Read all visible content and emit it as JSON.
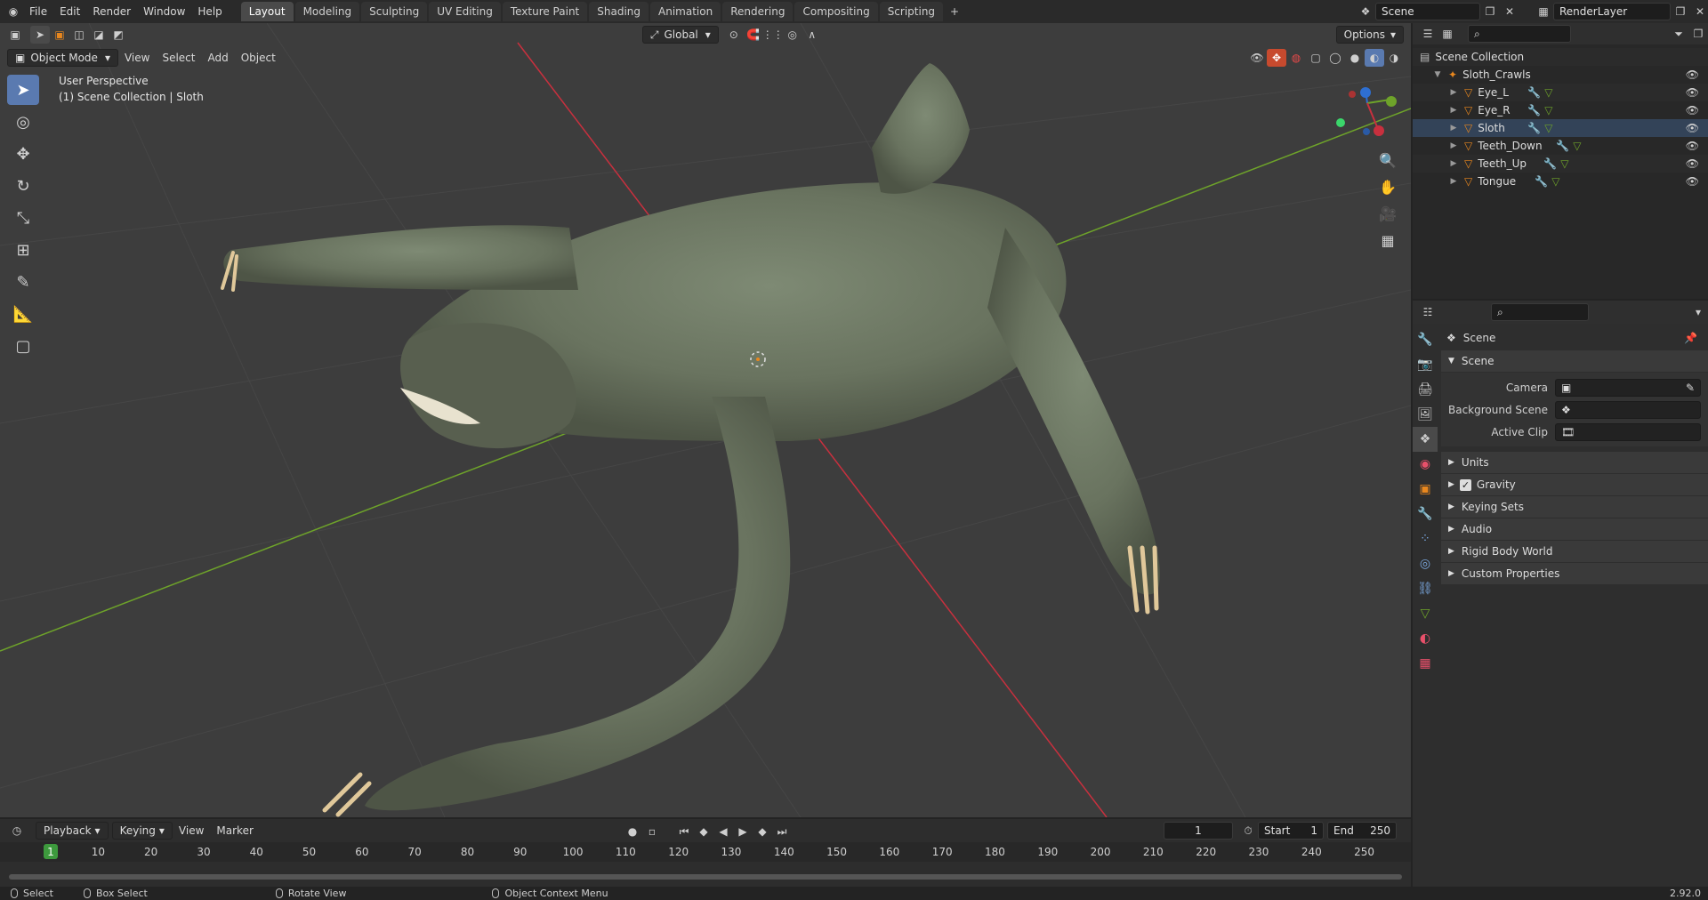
{
  "menu": {
    "file": "File",
    "edit": "Edit",
    "render": "Render",
    "window": "Window",
    "help": "Help"
  },
  "workspaces": [
    "Layout",
    "Modeling",
    "Sculpting",
    "UV Editing",
    "Texture Paint",
    "Shading",
    "Animation",
    "Rendering",
    "Compositing",
    "Scripting"
  ],
  "topright": {
    "scene": "Scene",
    "render_layer": "RenderLayer",
    "add_tab": "+"
  },
  "viewport": {
    "mode": "Object Mode",
    "view": "View",
    "select": "Select",
    "add": "Add",
    "object": "Object",
    "orientation": "Global",
    "options": "Options",
    "info_line1": "User Perspective",
    "info_line2": "(1) Scene Collection | Sloth"
  },
  "outliner": {
    "root": "Scene Collection",
    "collection": "Sloth_Crawls",
    "objects": [
      "Eye_L",
      "Eye_R",
      "Sloth",
      "Teeth_Down",
      "Teeth_Up",
      "Tongue"
    ]
  },
  "properties": {
    "context": "Scene",
    "panel_scene": "Scene",
    "camera_label": "Camera",
    "bg_scene_label": "Background Scene",
    "active_clip_label": "Active Clip",
    "subpanels": [
      "Units",
      "Gravity",
      "Keying Sets",
      "Audio",
      "Rigid Body World",
      "Custom Properties"
    ]
  },
  "timeline": {
    "playback": "Playback",
    "keying": "Keying",
    "view": "View",
    "marker": "Marker",
    "current_frame": "1",
    "start_label": "Start",
    "start": "1",
    "end_label": "End",
    "end": "250",
    "ticks": [
      "1",
      "10",
      "20",
      "30",
      "40",
      "50",
      "60",
      "70",
      "80",
      "90",
      "100",
      "110",
      "120",
      "130",
      "140",
      "150",
      "160",
      "170",
      "180",
      "190",
      "200",
      "210",
      "220",
      "230",
      "240",
      "250"
    ]
  },
  "status": {
    "select": "Select",
    "box_select": "Box Select",
    "rotate_view": "Rotate View",
    "context_menu": "Object Context Menu",
    "version": "2.92.0"
  },
  "colors": {
    "accent": "#5a7ab0",
    "x_axis": "#c8303e",
    "y_axis": "#6ea32a",
    "z_axis": "#2e6fd1",
    "object_orange": "#e8871e"
  }
}
